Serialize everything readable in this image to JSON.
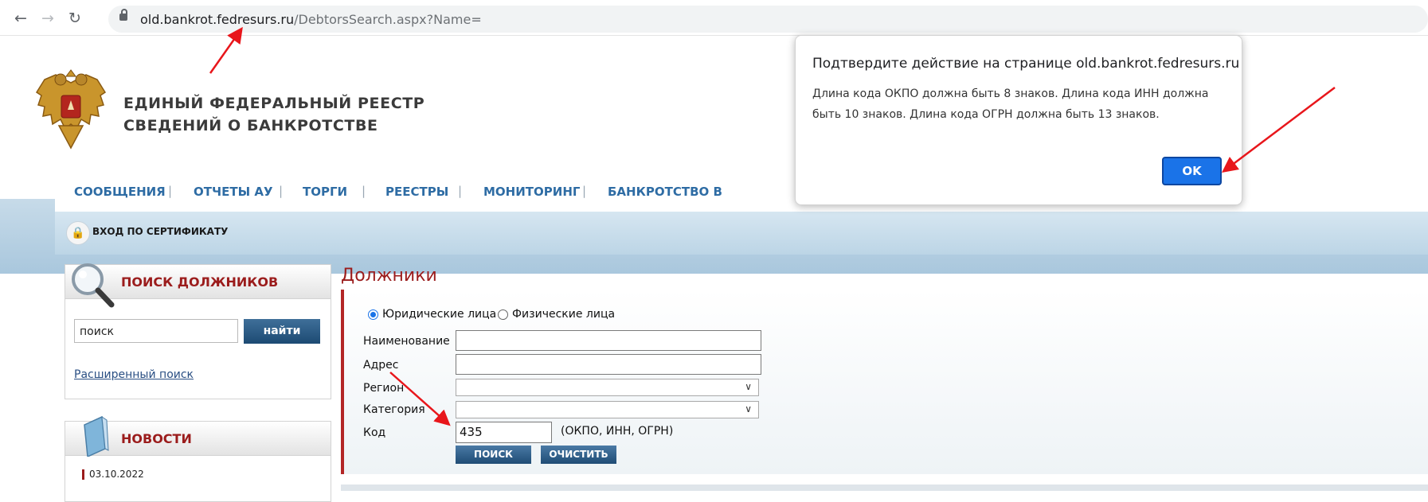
{
  "browser": {
    "url_host": "old.bankrot.fedresurs.ru",
    "url_path": "/DebtorsSearch.aspx?Name="
  },
  "site": {
    "title_line1": "ЕДИНЫЙ  ФЕДЕРАЛЬНЫЙ  РЕЕСТР",
    "title_line2": "СВЕДЕНИЙ О БАНКРОТСТВЕ"
  },
  "menu": {
    "items": [
      "СООБЩЕНИЯ",
      "ОТЧЕТЫ АУ",
      "ТОРГИ",
      "РЕЕСТРЫ",
      "МОНИТОРИНГ",
      "БАНКРОТСТВО В"
    ],
    "separator": "|"
  },
  "cert": {
    "label": "ВХОД ПО СЕРТИФИКАТУ"
  },
  "search_panel": {
    "title": "ПОИСК ДОЛЖНИКОВ",
    "input_value": "поиск",
    "button": "найти",
    "advanced_link": "Расширенный поиск"
  },
  "news_panel": {
    "title": "НОВОСТИ",
    "first_date": "03.10.2022"
  },
  "main": {
    "title": "Должники",
    "radio_legal": "Юридические лица",
    "radio_physical": "Физические лица",
    "radio_selected": "legal",
    "label_name": "Наименование",
    "label_address": "Адрес",
    "label_region": "Регион",
    "label_category": "Категория",
    "label_code": "Код",
    "code_value": "435",
    "code_hint": "(ОКПО, ИНН, ОГРН)",
    "search_button": "ПОИСК",
    "clear_button": "ОЧИСТИТЬ"
  },
  "dialog": {
    "title": "Подтвердите действие на странице old.bankrot.fedresurs.ru",
    "message": "Длина кода ОКПО должна быть 8 знаков. Длина кода ИНН должна быть 10 знаков. Длина кода ОГРН должна быть 13 знаков.",
    "ok": "OK"
  },
  "colors": {
    "brand_red": "#9b1c1c",
    "menu_blue": "#2e6ca4",
    "dialog_ok": "#1a73e8",
    "annotation_arrow": "#e8161b"
  },
  "icons": [
    "back-arrow-icon",
    "forward-arrow-icon",
    "reload-icon",
    "lock-icon",
    "emblem-icon",
    "certificate-lock-icon",
    "magnifier-icon",
    "book-icon",
    "chevron-down-icon"
  ]
}
